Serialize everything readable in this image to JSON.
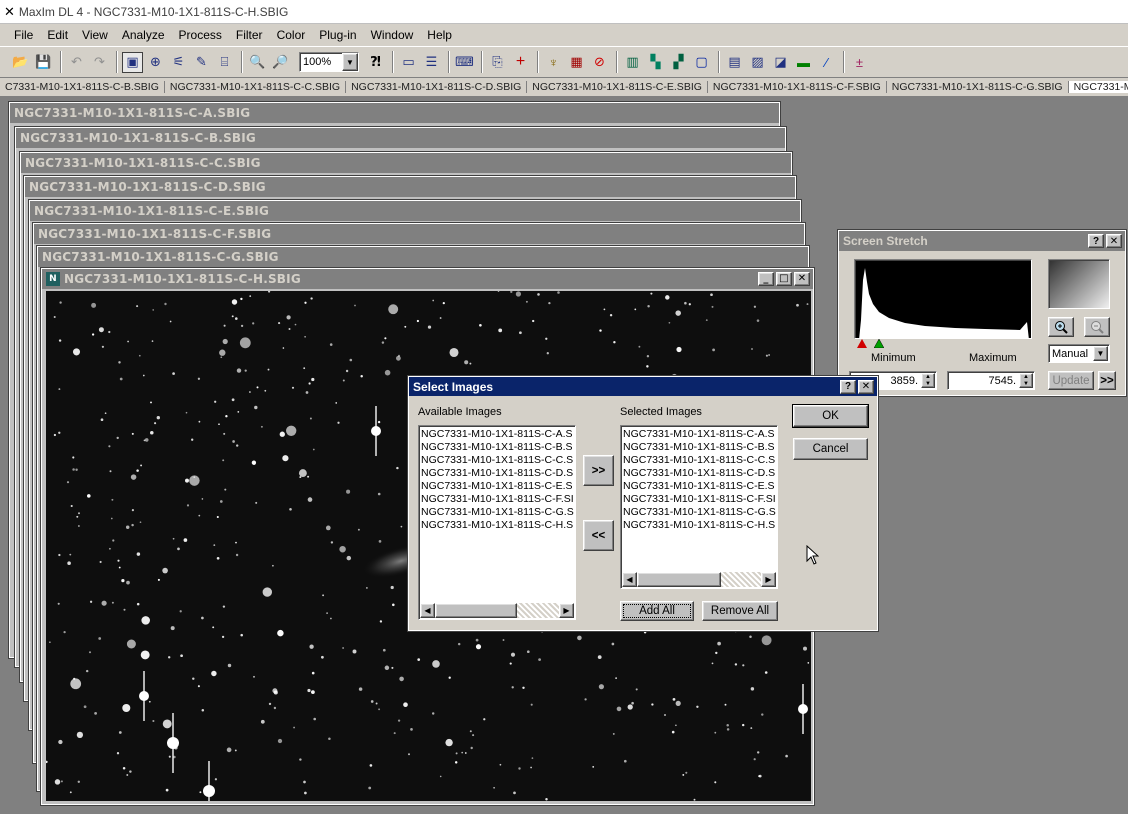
{
  "app": {
    "title": "MaxIm DL 4 - NGC7331-M10-1X1-811S-C-H.SBIG"
  },
  "menu": {
    "items": [
      {
        "label": "File"
      },
      {
        "label": "Edit"
      },
      {
        "label": "View"
      },
      {
        "label": "Analyze"
      },
      {
        "label": "Process"
      },
      {
        "label": "Filter"
      },
      {
        "label": "Color"
      },
      {
        "label": "Plug-in"
      },
      {
        "label": "Window"
      },
      {
        "label": "Help"
      }
    ]
  },
  "toolbar": {
    "zoom_value": "100%"
  },
  "doc_tabs": [
    {
      "label": "C7331-M10-1X1-811S-C-B.SBIG"
    },
    {
      "label": "NGC7331-M10-1X1-811S-C-C.SBIG"
    },
    {
      "label": "NGC7331-M10-1X1-811S-C-D.SBIG"
    },
    {
      "label": "NGC7331-M10-1X1-811S-C-E.SBIG"
    },
    {
      "label": "NGC7331-M10-1X1-811S-C-F.SBIG"
    },
    {
      "label": "NGC7331-M10-1X1-811S-C-G.SBIG"
    },
    {
      "label": "NGC7331-M"
    }
  ],
  "image_windows": [
    {
      "title": "NGC7331-M10-1X1-811S-C-A.SBIG"
    },
    {
      "title": "NGC7331-M10-1X1-811S-C-B.SBIG"
    },
    {
      "title": "NGC7331-M10-1X1-811S-C-C.SBIG"
    },
    {
      "title": "NGC7331-M10-1X1-811S-C-D.SBIG"
    },
    {
      "title": "NGC7331-M10-1X1-811S-C-E.SBIG"
    },
    {
      "title": "NGC7331-M10-1X1-811S-C-F.SBIG"
    },
    {
      "title": "NGC7331-M10-1X1-811S-C-G.SBIG"
    },
    {
      "title": "NGC7331-M10-1X1-811S-C-H.SBIG"
    }
  ],
  "screen_stretch": {
    "title": "Screen Stretch",
    "minimum_label": "Minimum",
    "maximum_label": "Maximum",
    "minimum_value": "3859.",
    "maximum_value": "7545.",
    "mode": "Manual",
    "update_label": "Update",
    "more_label": ">>"
  },
  "dialog": {
    "title": "Select Images",
    "available_label": "Available Images",
    "selected_label": "Selected Images",
    "available_items": [
      "NGC7331-M10-1X1-811S-C-A.S",
      "NGC7331-M10-1X1-811S-C-B.S",
      "NGC7331-M10-1X1-811S-C-C.S",
      "NGC7331-M10-1X1-811S-C-D.S",
      "NGC7331-M10-1X1-811S-C-E.S",
      "NGC7331-M10-1X1-811S-C-F.SI",
      "NGC7331-M10-1X1-811S-C-G.S",
      "NGC7331-M10-1X1-811S-C-H.S"
    ],
    "selected_items": [
      "NGC7331-M10-1X1-811S-C-A.S",
      "NGC7331-M10-1X1-811S-C-B.S",
      "NGC7331-M10-1X1-811S-C-C.S",
      "NGC7331-M10-1X1-811S-C-D.S",
      "NGC7331-M10-1X1-811S-C-E.S",
      "NGC7331-M10-1X1-811S-C-F.SI",
      "NGC7331-M10-1X1-811S-C-G.S",
      "NGC7331-M10-1X1-811S-C-H.S"
    ],
    "add_arrow": ">>",
    "remove_arrow": "<<",
    "ok_label": "OK",
    "cancel_label": "Cancel",
    "add_all_label": "Add All",
    "remove_all_label": "Remove All"
  }
}
